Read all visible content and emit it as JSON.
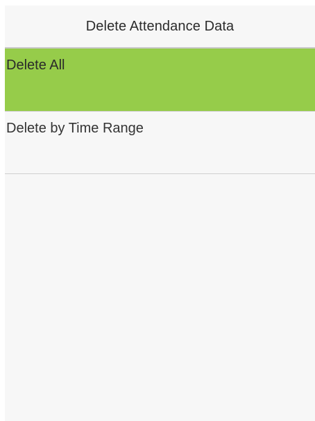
{
  "header": {
    "title": "Delete Attendance Data"
  },
  "menu": {
    "items": [
      {
        "label": "Delete All",
        "selected": true
      },
      {
        "label": "Delete by Time Range",
        "selected": false
      }
    ]
  },
  "colors": {
    "selected_background": "#96cc4a",
    "screen_background": "#f7f7f7",
    "divider": "#c9c9c9"
  }
}
